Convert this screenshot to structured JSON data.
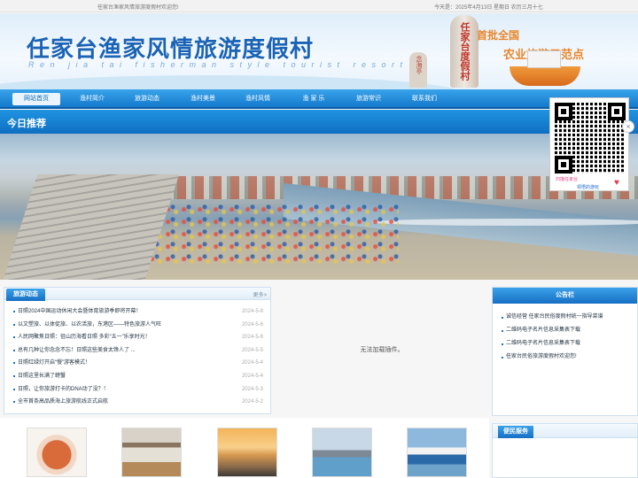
{
  "topbar": {
    "welcome": "任家台渔家风情旅游度假村欢迎您!",
    "date": "今天是：2025年4月13日 星期日 农历三月十七"
  },
  "banner": {
    "title": "任家台渔家风情旅游度假村",
    "pinyin": "Ren jia tai fisherman style tourist resort",
    "stone_text": "任家台度假村",
    "small_stone_text": "念海亭",
    "slogan_line1": "首批全国",
    "slogan_line2": "农业旅游示范点"
  },
  "nav": {
    "items": [
      {
        "label": "网站首页",
        "active": true
      },
      {
        "label": "渔村简介",
        "active": false
      },
      {
        "label": "旅游动态",
        "active": false
      },
      {
        "label": "渔村美景",
        "active": false
      },
      {
        "label": "渔村风情",
        "active": false
      },
      {
        "label": "渔 家 乐",
        "active": false
      },
      {
        "label": "旅游常识",
        "active": false
      },
      {
        "label": "联系我们",
        "active": false
      }
    ]
  },
  "today": {
    "label": "今日推荐"
  },
  "qr": {
    "caption1": "扫描任家台",
    "caption2": "领悟的游玩"
  },
  "news": {
    "tab": "旅游动态",
    "more": "更多>",
    "items": [
      {
        "title": "日照2024中国运动休闲大会暨体育旅游季即将开幕！",
        "date": "2024-5-8"
      },
      {
        "title": "以文塑旅、以体促旅、以农活旅，东港区——特色旅游人气旺",
        "date": "2024-5-6"
      },
      {
        "title": "人民网聚焦日照：徂山历海看日照 多彩“五一”乐享时光！",
        "date": "2024-5-6"
      },
      {
        "title": "总有几种让你念念不忘！日照这些美食太馋人了 ...",
        "date": "2024-5-5"
      },
      {
        "title": "日照红绿灯开启“慢”游客模式！",
        "date": "2024-5-4"
      },
      {
        "title": "日照这里长满了螃蟹",
        "date": "2024-5-4"
      },
      {
        "title": "日照，让你旅游打卡的DNA动了没？！",
        "date": "2024-5-3"
      },
      {
        "title": "全市首条高品质海上旅游航线正式启航",
        "date": "2024-5-2"
      }
    ]
  },
  "plugin": {
    "message": "无法加载插件。"
  },
  "notice": {
    "title": "公告栏",
    "items": [
      "诚信经营 任家台民俗度假村统一指导菜谱",
      "二维码电子名片信息采集表下载",
      "二维码电子名片信息采集表下载",
      "任家台民俗旅游度假村欢迎您!"
    ]
  },
  "thumbs": [
    {
      "name": "seafood"
    },
    {
      "name": "room"
    },
    {
      "name": "sunset"
    },
    {
      "name": "pier"
    },
    {
      "name": "ship"
    }
  ],
  "service": {
    "title": "便民服务"
  }
}
